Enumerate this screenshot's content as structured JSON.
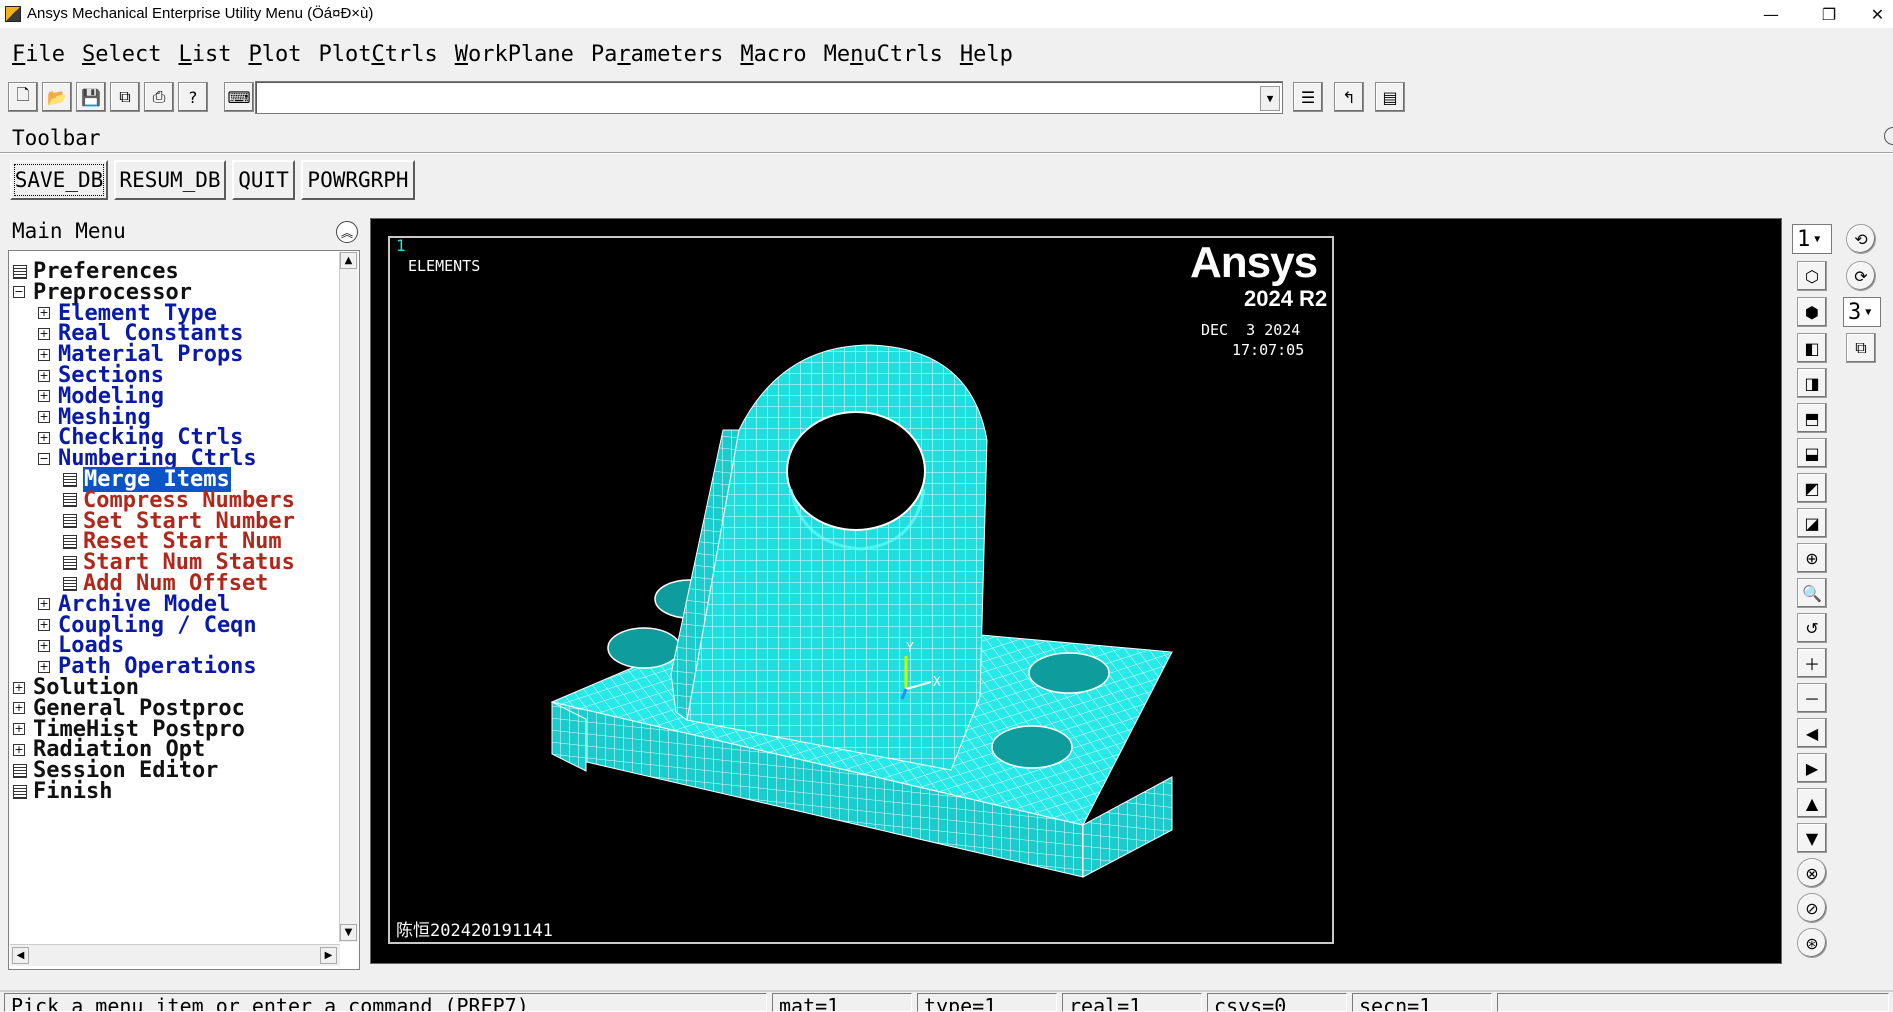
{
  "window": {
    "title": "Ansys Mechanical Enterprise Utility Menu (Öá¤Ð×ù)",
    "minimize_glyph": "—",
    "maximize_glyph": "❐",
    "close_glyph": "✕"
  },
  "menubar": [
    {
      "pre": "",
      "key": "F",
      "post": "ile"
    },
    {
      "pre": "",
      "key": "S",
      "post": "elect"
    },
    {
      "pre": "",
      "key": "L",
      "post": "ist"
    },
    {
      "pre": "",
      "key": "P",
      "post": "lot"
    },
    {
      "pre": "Plot",
      "key": "C",
      "post": "trls"
    },
    {
      "pre": "",
      "key": "W",
      "post": "orkPlane"
    },
    {
      "pre": "Pa",
      "key": "r",
      "post": "ameters"
    },
    {
      "pre": "",
      "key": "M",
      "post": "acro"
    },
    {
      "pre": "Me",
      "key": "n",
      "post": "uCtrls"
    },
    {
      "pre": "",
      "key": "H",
      "post": "elp"
    }
  ],
  "command_input": {
    "value": ""
  },
  "toolbar": {
    "label": "Toolbar",
    "buttons": [
      "SAVE_DB",
      "RESUM_DB",
      "QUIT",
      "POWRGRPH"
    ]
  },
  "main_menu": {
    "title": "Main Menu",
    "items": [
      {
        "label": "Preferences",
        "level": 0,
        "icon": "leaf",
        "color": "black"
      },
      {
        "label": "Preprocessor",
        "level": 0,
        "icon": "collapse",
        "color": "black"
      },
      {
        "label": "Element Type",
        "level": 1,
        "icon": "expand",
        "color": "blue"
      },
      {
        "label": "Real Constants",
        "level": 1,
        "icon": "expand",
        "color": "blue"
      },
      {
        "label": "Material Props",
        "level": 1,
        "icon": "expand",
        "color": "blue"
      },
      {
        "label": "Sections",
        "level": 1,
        "icon": "expand",
        "color": "blue"
      },
      {
        "label": "Modeling",
        "level": 1,
        "icon": "expand",
        "color": "blue"
      },
      {
        "label": "Meshing",
        "level": 1,
        "icon": "expand",
        "color": "blue"
      },
      {
        "label": "Checking Ctrls",
        "level": 1,
        "icon": "expand",
        "color": "blue"
      },
      {
        "label": "Numbering Ctrls",
        "level": 1,
        "icon": "collapse",
        "color": "blue"
      },
      {
        "label": "Merge Items",
        "level": 2,
        "icon": "leaf",
        "color": "red",
        "selected": true
      },
      {
        "label": "Compress Numbers",
        "level": 2,
        "icon": "leaf",
        "color": "red"
      },
      {
        "label": "Set Start Number",
        "level": 2,
        "icon": "leaf",
        "color": "red"
      },
      {
        "label": "Reset Start Num",
        "level": 2,
        "icon": "leaf",
        "color": "red"
      },
      {
        "label": "Start Num Status",
        "level": 2,
        "icon": "leaf",
        "color": "red"
      },
      {
        "label": "Add Num Offset",
        "level": 2,
        "icon": "leaf",
        "color": "red"
      },
      {
        "label": "Archive Model",
        "level": 1,
        "icon": "expand",
        "color": "blue"
      },
      {
        "label": "Coupling / Ceqn",
        "level": 1,
        "icon": "expand",
        "color": "blue"
      },
      {
        "label": "Loads",
        "level": 1,
        "icon": "expand",
        "color": "blue"
      },
      {
        "label": "Path Operations",
        "level": 1,
        "icon": "expand",
        "color": "blue"
      },
      {
        "label": "Solution",
        "level": 0,
        "icon": "expand",
        "color": "black"
      },
      {
        "label": "General Postproc",
        "level": 0,
        "icon": "expand",
        "color": "black"
      },
      {
        "label": "TimeHist Postpro",
        "level": 0,
        "icon": "expand",
        "color": "black"
      },
      {
        "label": "Radiation Opt",
        "level": 0,
        "icon": "expand",
        "color": "black"
      },
      {
        "label": "Session Editor",
        "level": 0,
        "icon": "leaf",
        "color": "black"
      },
      {
        "label": "Finish",
        "level": 0,
        "icon": "leaf",
        "color": "black"
      }
    ]
  },
  "graphics": {
    "window_number": "1",
    "plot_label": "ELEMENTS",
    "brand": "Ansys",
    "version": "2024 R2",
    "date": "DEC  3 2024",
    "time": "17:07:05",
    "caption": "陈恒202420191141",
    "triad_x": "X",
    "triad_y": "Y",
    "mesh_color": "#1ee6e6",
    "background_color": "#000000"
  },
  "side_controls": {
    "window_select": "1",
    "zoom_select": "3"
  },
  "statusbar": {
    "prompt": "Pick a menu item or enter a command (PREP7)",
    "mat": "mat=1",
    "type": "type=1",
    "real": "real=1",
    "csys": "csys=0",
    "secn": "secn=1"
  }
}
